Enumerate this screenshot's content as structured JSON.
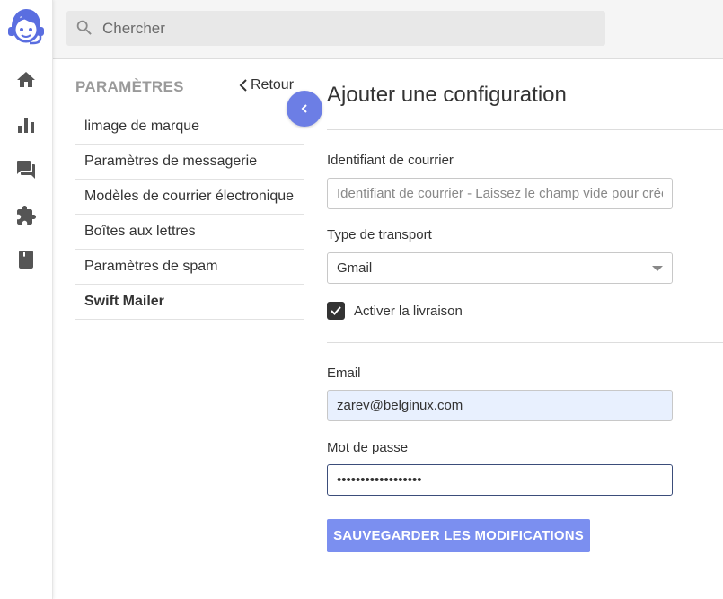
{
  "search": {
    "placeholder": "Chercher"
  },
  "rail": {
    "items": [
      {
        "icon": "home-icon"
      },
      {
        "icon": "bar-chart-icon"
      },
      {
        "icon": "chat-icon"
      },
      {
        "icon": "puzzle-icon"
      },
      {
        "icon": "book-icon"
      }
    ]
  },
  "sidebar": {
    "title": "PARAMÈTRES",
    "back_label": "Retour",
    "items": [
      {
        "label": "limage de marque"
      },
      {
        "label": "Paramètres de messagerie"
      },
      {
        "label": "Modèles de courrier électronique"
      },
      {
        "label": "Boîtes aux lettres"
      },
      {
        "label": "Paramètres de spam"
      },
      {
        "label": "Swift Mailer"
      }
    ]
  },
  "main": {
    "title": "Ajouter une configuration",
    "mail_id_label": "Identifiant de courrier",
    "mail_id_placeholder": "Identifiant de courrier - Laissez le champ vide pour créer",
    "transport_label": "Type de transport",
    "transport_value": "Gmail",
    "delivery_label": "Activer la livraison",
    "delivery_checked": true,
    "email_label": "Email",
    "email_value": "zarev@belginux.com",
    "password_label": "Mot de passe",
    "password_value": "••••••••••••••••••",
    "save_label": "SAUVEGARDER LES MODIFICATIONS"
  },
  "colors": {
    "accent": "#6c7ee5",
    "button": "#7b8ff0",
    "logo": "#5a6ee0"
  }
}
